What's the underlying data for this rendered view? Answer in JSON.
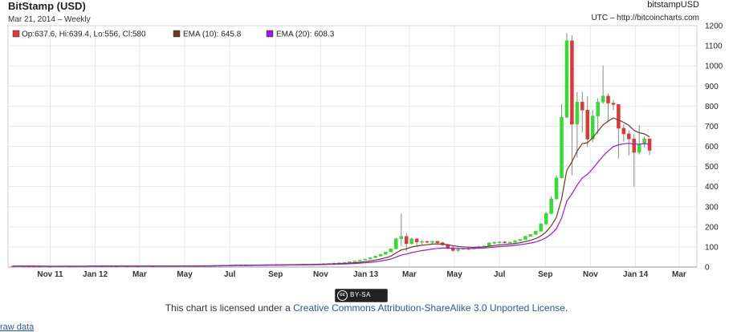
{
  "header": {
    "title": "BitStamp (USD)",
    "subtitle": "Mar 21, 2014 – Weekly",
    "symbol": "bitstampUSD",
    "source": "UTC – http://bitcoincharts.com"
  },
  "legend": {
    "ohlc": "Op:637.6, Hi:639.4, Lo:556, Cl:580",
    "ema10": "EMA (10): 645.8",
    "ema20": "EMA (20): 608.3"
  },
  "colors": {
    "up": "#33dd33",
    "down": "#e23636",
    "ema10": "#6b3a1f",
    "ema20": "#9a17e8",
    "grid": "#e8e8e8",
    "axis": "#999999"
  },
  "license": {
    "badge": "BY-SA",
    "prefix": "This chart is licensed under a ",
    "link": "Creative Commons Attribution-ShareAlike 3.0 Unported License",
    "suffix": "."
  },
  "footer_link": "raw data",
  "chart_data": {
    "type": "candlestick",
    "interval": "weekly",
    "ylim": [
      0,
      1200
    ],
    "yticks": [
      0,
      100,
      200,
      300,
      400,
      500,
      600,
      700,
      800,
      900,
      1000,
      1100,
      1200
    ],
    "xticks": [
      {
        "label": "Nov 11",
        "x": "2011-11-01"
      },
      {
        "label": "Jan 12",
        "x": "2012-01-01"
      },
      {
        "label": "Mar",
        "x": "2012-03-01"
      },
      {
        "label": "May",
        "x": "2012-05-01"
      },
      {
        "label": "Jul",
        "x": "2012-07-01"
      },
      {
        "label": "Sep",
        "x": "2012-09-01"
      },
      {
        "label": "Nov",
        "x": "2012-11-01"
      },
      {
        "label": "Jan 13",
        "x": "2013-01-01"
      },
      {
        "label": "Mar",
        "x": "2013-03-01"
      },
      {
        "label": "May",
        "x": "2013-05-01"
      },
      {
        "label": "Jul",
        "x": "2013-07-01"
      },
      {
        "label": "Sep",
        "x": "2013-09-01"
      },
      {
        "label": "Nov",
        "x": "2013-11-01"
      },
      {
        "label": "Jan 14",
        "x": "2014-01-01"
      },
      {
        "label": "Mar",
        "x": "2014-03-01"
      }
    ],
    "grid": true,
    "series": [
      {
        "kind": "ohlc",
        "start": "2011-09-12",
        "points": [
          [
            5.5,
            6,
            4.5,
            4.8
          ],
          [
            4.8,
            5.5,
            4.2,
            5.2
          ],
          [
            5.2,
            5.6,
            4.5,
            4.6
          ],
          [
            4.6,
            5,
            3.8,
            4.1
          ],
          [
            4.1,
            4.4,
            3.2,
            3.3
          ],
          [
            3.3,
            3.8,
            2.2,
            2.6
          ],
          [
            2.6,
            3.5,
            2.3,
            3.1
          ],
          [
            3.1,
            3.4,
            2.5,
            2.9
          ],
          [
            2.9,
            3.5,
            2.6,
            3.2
          ],
          [
            3.2,
            4.2,
            3,
            4
          ],
          [
            4,
            4.8,
            3.7,
            4.4
          ],
          [
            4.4,
            4.5,
            3.9,
            4.1
          ],
          [
            4.1,
            4.3,
            3.6,
            3.7
          ],
          [
            3.7,
            4,
            3.3,
            3.9
          ],
          [
            3.9,
            4.8,
            3.8,
            4.6
          ],
          [
            4.6,
            7.3,
            4.5,
            6.8
          ],
          [
            6.8,
            7.2,
            5.8,
            6
          ],
          [
            6,
            6.4,
            5.5,
            5.6
          ],
          [
            5.6,
            6.2,
            5.3,
            5.9
          ],
          [
            5.9,
            6.1,
            5,
            5.3
          ],
          [
            5.3,
            5.5,
            4.2,
            4.5
          ],
          [
            4.5,
            5.1,
            4.3,
            5
          ],
          [
            5,
            5.2,
            4.7,
            4.9
          ],
          [
            4.9,
            5.1,
            4.7,
            5
          ],
          [
            5,
            5.3,
            4.8,
            4.9
          ],
          [
            4.9,
            5.1,
            4.8,
            5
          ],
          [
            5,
            5.2,
            4.8,
            5.1
          ],
          [
            5.1,
            5.2,
            4.9,
            5
          ],
          [
            5,
            5.1,
            4.8,
            5
          ],
          [
            5,
            5.1,
            4.9,
            5.1
          ],
          [
            5.1,
            5.3,
            5,
            5.2
          ],
          [
            5.2,
            5.4,
            5.1,
            5.3
          ],
          [
            5.3,
            5.6,
            5.2,
            5.5
          ],
          [
            5.5,
            5.7,
            5.3,
            5.6
          ],
          [
            5.6,
            6,
            5.5,
            5.9
          ],
          [
            5.9,
            6.5,
            5.8,
            6.4
          ],
          [
            6.4,
            6.8,
            6.2,
            6.6
          ],
          [
            6.6,
            6.9,
            6.4,
            6.7
          ],
          [
            6.7,
            7.2,
            6.6,
            7.1
          ],
          [
            7.1,
            7.8,
            7,
            7.6
          ],
          [
            7.6,
            8.5,
            7.5,
            8.4
          ],
          [
            8.4,
            9.2,
            8.2,
            9
          ],
          [
            9,
            10.5,
            8.8,
            10.3
          ],
          [
            10.3,
            11.5,
            10,
            11
          ],
          [
            11,
            11.8,
            10.5,
            10.8
          ],
          [
            10.8,
            11.2,
            9.5,
            10
          ],
          [
            10,
            10.6,
            9.8,
            10.4
          ],
          [
            10.4,
            11,
            10.2,
            10.9
          ],
          [
            10.9,
            11.5,
            10.7,
            11.3
          ],
          [
            11.3,
            12,
            11,
            11.8
          ],
          [
            11.8,
            12.5,
            11.6,
            12.2
          ],
          [
            12.2,
            12.6,
            11.5,
            11.8
          ],
          [
            11.8,
            12.3,
            11.6,
            12.1
          ],
          [
            12.1,
            13,
            12,
            12.8
          ],
          [
            12.8,
            13.3,
            12.5,
            13.1
          ],
          [
            13.1,
            13.6,
            12.9,
            13.4
          ],
          [
            13.4,
            14,
            13.2,
            13.8
          ],
          [
            13.8,
            14.3,
            13.5,
            14.1
          ],
          [
            14.1,
            15,
            14,
            14.8
          ],
          [
            14.8,
            16,
            14.6,
            15.8
          ],
          [
            15.8,
            17.2,
            15.6,
            17
          ],
          [
            17,
            18.5,
            16.8,
            18.3
          ],
          [
            18.3,
            20,
            18,
            19.7
          ],
          [
            19.7,
            22,
            19.5,
            21.5
          ],
          [
            21.5,
            24,
            21.2,
            23.6
          ],
          [
            23.6,
            27,
            23.4,
            26.5
          ],
          [
            26.5,
            31,
            26.2,
            30.5
          ],
          [
            30.5,
            35,
            30,
            34.6
          ],
          [
            34.6,
            40,
            34,
            39.5
          ],
          [
            39.5,
            47,
            39,
            46.2
          ],
          [
            46.2,
            55,
            45.5,
            54
          ],
          [
            54,
            64,
            53,
            63.2
          ],
          [
            63.2,
            76,
            62,
            75
          ],
          [
            75,
            92,
            74,
            91
          ],
          [
            91,
            145,
            88,
            141
          ],
          [
            141,
            266,
            105,
            152
          ],
          [
            152,
            170,
            78,
            116
          ],
          [
            116,
            146,
            112,
            140
          ],
          [
            140,
            145,
            102,
            125
          ],
          [
            125,
            134,
            112,
            127
          ],
          [
            127,
            132,
            118,
            123
          ],
          [
            123,
            130,
            116,
            128
          ],
          [
            128,
            130,
            117,
            121
          ],
          [
            121,
            125,
            106,
            110
          ],
          [
            110,
            112,
            88,
            96
          ],
          [
            96,
            102,
            76,
            82
          ],
          [
            82,
            98,
            75,
            88
          ],
          [
            88,
            96,
            85,
            92
          ],
          [
            92,
            97,
            86,
            90
          ],
          [
            90,
            100,
            88,
            97
          ],
          [
            97,
            105,
            93,
            101
          ],
          [
            101,
            108,
            98,
            104
          ],
          [
            104,
            124,
            102,
            120
          ],
          [
            120,
            128,
            113,
            122
          ],
          [
            122,
            129,
            117,
            125
          ],
          [
            125,
            130,
            118,
            122
          ],
          [
            122,
            128,
            117,
            123
          ],
          [
            123,
            133,
            121,
            131
          ],
          [
            131,
            140,
            127,
            137
          ],
          [
            137,
            156,
            134,
            153
          ],
          [
            153,
            165,
            150,
            162
          ],
          [
            162,
            182,
            160,
            178
          ],
          [
            178,
            220,
            176,
            214
          ],
          [
            214,
            273,
            210,
            266
          ],
          [
            266,
            352,
            262,
            339
          ],
          [
            339,
            455,
            335,
            443
          ],
          [
            443,
            810,
            440,
            745
          ],
          [
            745,
            1163,
            740,
            1125
          ],
          [
            1125,
            1152,
            455,
            710
          ],
          [
            710,
            870,
            544,
            820
          ],
          [
            820,
            870,
            670,
            780
          ],
          [
            780,
            850,
            596,
            636
          ],
          [
            636,
            780,
            621,
            751
          ],
          [
            751,
            840,
            660,
            820
          ],
          [
            820,
            1000,
            810,
            850
          ],
          [
            850,
            863,
            720,
            815
          ],
          [
            815,
            830,
            780,
            808
          ],
          [
            808,
            810,
            540,
            690
          ],
          [
            690,
            710,
            623,
            662
          ],
          [
            662,
            680,
            555,
            637
          ],
          [
            637,
            660,
            400,
            570
          ],
          [
            570,
            705,
            560,
            612
          ],
          [
            612,
            650,
            593,
            637
          ],
          [
            637.6,
            639.4,
            556,
            580
          ]
        ]
      },
      {
        "name": "EMA (10)",
        "kind": "line",
        "values": "computed"
      },
      {
        "name": "EMA (20)",
        "kind": "line",
        "values": "computed"
      }
    ]
  }
}
